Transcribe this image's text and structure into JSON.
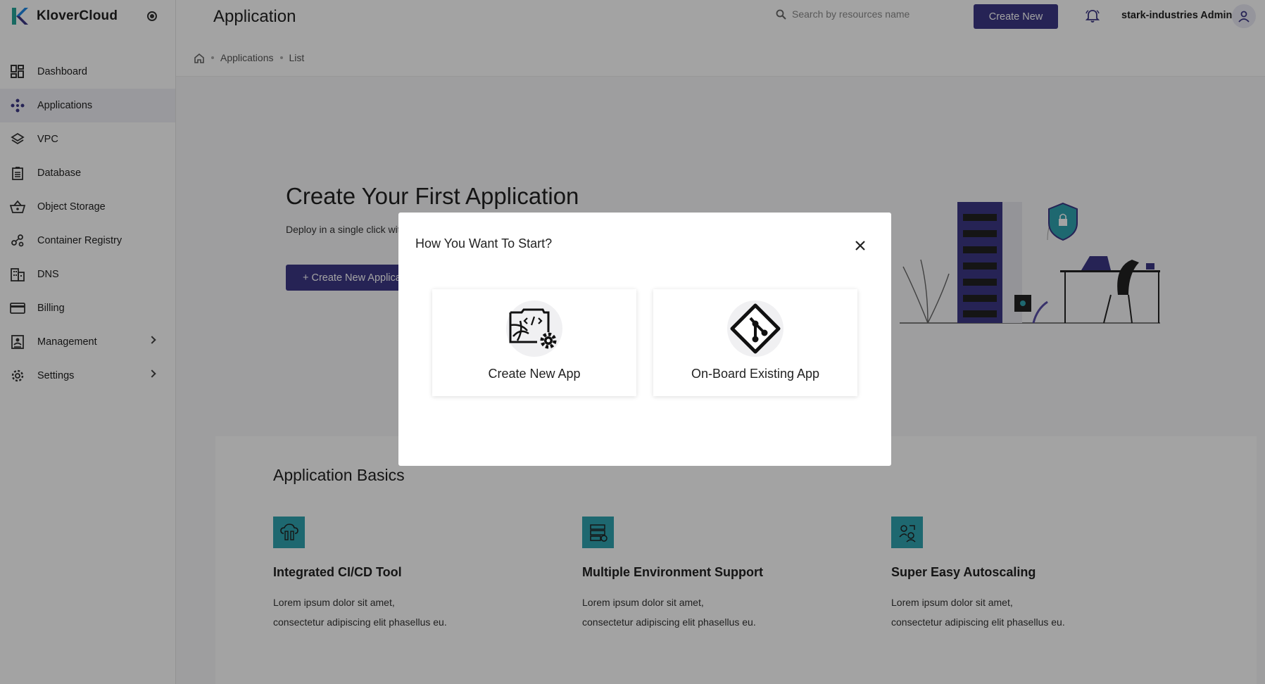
{
  "sidebar": {
    "brand": "KloverCloud",
    "items": [
      {
        "label": "Dashboard",
        "icon": "dashboard-icon"
      },
      {
        "label": "Applications",
        "icon": "applications-icon",
        "active": true
      },
      {
        "label": "VPC",
        "icon": "layers-icon"
      },
      {
        "label": "Database",
        "icon": "database-icon"
      },
      {
        "label": "Object Storage",
        "icon": "basket-icon"
      },
      {
        "label": "Container Registry",
        "icon": "registry-icon"
      },
      {
        "label": "DNS",
        "icon": "building-icon"
      },
      {
        "label": "Billing",
        "icon": "card-icon"
      },
      {
        "label": "Management",
        "icon": "management-icon",
        "expandable": true
      },
      {
        "label": "Settings",
        "icon": "gear-icon",
        "expandable": true
      }
    ]
  },
  "header": {
    "title": "Application",
    "search_placeholder": "Search by resources name",
    "create_label": "Create New",
    "user": "stark-industries Admin"
  },
  "breadcrumb": [
    "Applications",
    "List"
  ],
  "hero": {
    "title": "Create Your First Application",
    "subtitle": "Deploy in a single click wit",
    "button": "+ Create New Applicat"
  },
  "basics": {
    "title": "Application Basics",
    "features": [
      {
        "title": "Integrated CI/CD Tool",
        "line1": "Lorem ipsum dolor sit amet,",
        "line2": "consectetur adipiscing elit phasellus eu."
      },
      {
        "title": "Multiple Environment Support",
        "line1": "Lorem ipsum dolor sit amet,",
        "line2": "consectetur adipiscing elit phasellus eu."
      },
      {
        "title": "Super Easy Autoscaling",
        "line1": "Lorem ipsum dolor sit amet,",
        "line2": "consectetur adipiscing elit phasellus eu."
      }
    ]
  },
  "modal": {
    "title": "How You Want To Start?",
    "options": [
      {
        "label": "Create New App",
        "icon": "code-gear-icon"
      },
      {
        "label": "On-Board Existing App",
        "icon": "git-icon"
      }
    ]
  },
  "colors": {
    "primary": "#3c3785",
    "accent": "#2fa3b0",
    "logo_blue": "#1e88e5",
    "logo_teal": "#26a69a"
  }
}
